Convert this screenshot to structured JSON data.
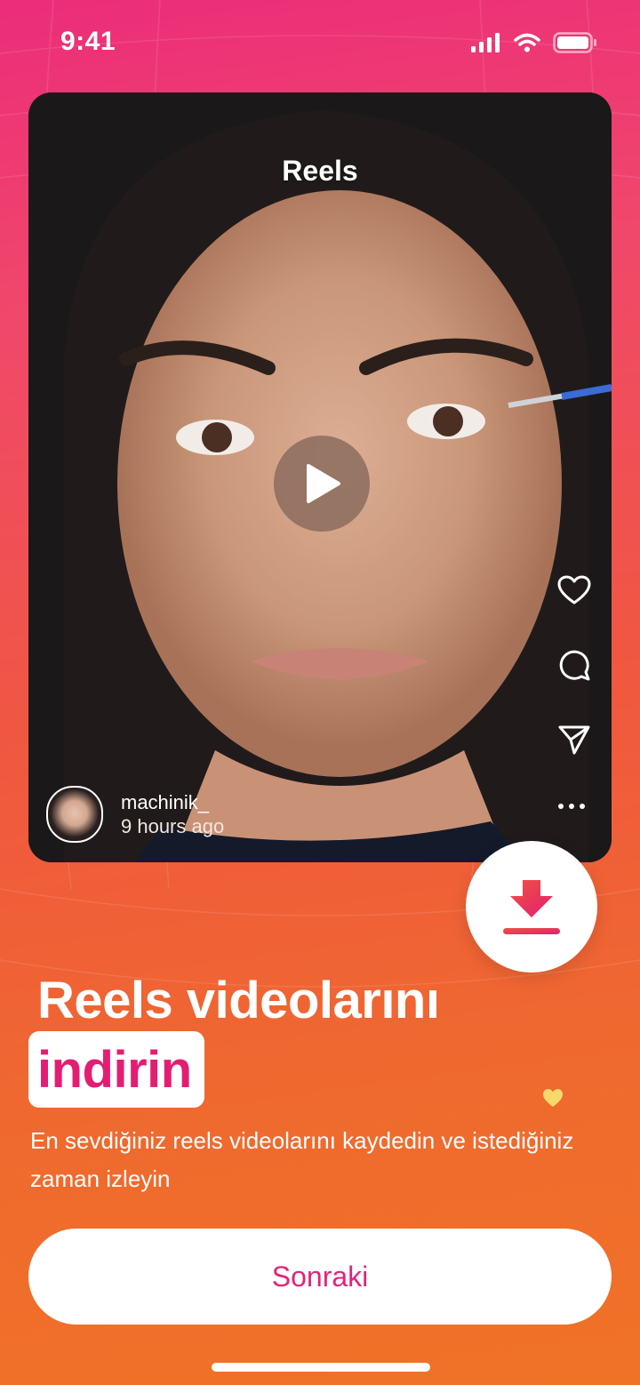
{
  "status_bar": {
    "time": "9:41"
  },
  "reel": {
    "title": "Reels",
    "author_name": "machinik_",
    "posted": "9 hours ago"
  },
  "headline": {
    "line1": "Reels videolarını",
    "highlight": "indirin"
  },
  "subtitle": "En sevdiğiniz reels videolarını kaydedin ve istediğiniz zaman izleyin",
  "primary_button": {
    "label": "Sonraki"
  },
  "colors": {
    "accent": "#e31e72",
    "gradient_top": "#ec2d7a",
    "gradient_bottom": "#f07227",
    "heart_deco": "#f7d86a"
  }
}
